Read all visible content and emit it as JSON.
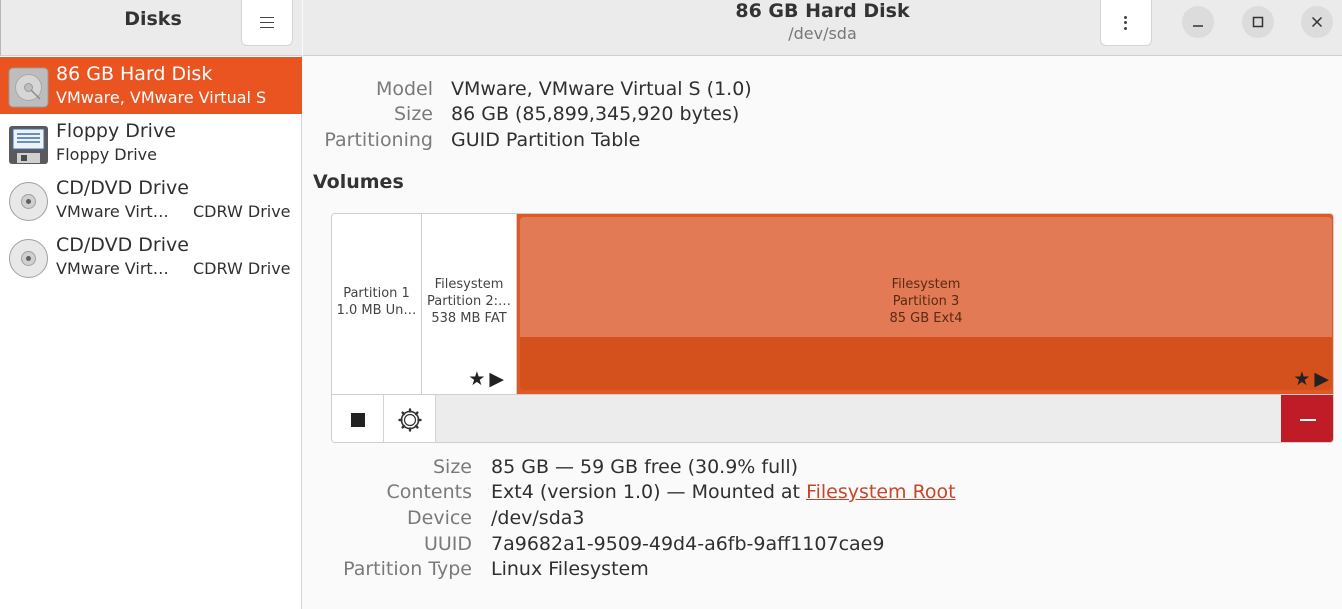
{
  "sidebar": {
    "title": "Disks",
    "menu_icon": "hamburger-menu-icon",
    "devices": [
      {
        "name": "86 GB Hard Disk",
        "sub": "VMware, VMware Virtual S",
        "sub2": "",
        "icon": "hard-disk-icon",
        "selected": true
      },
      {
        "name": "Floppy Drive",
        "sub": "Floppy Drive",
        "sub2": "",
        "icon": "floppy-drive-icon",
        "selected": false
      },
      {
        "name": "CD/DVD Drive",
        "sub": "VMware Virt…",
        "sub2": "CDRW Drive",
        "icon": "optical-drive-icon",
        "selected": false
      },
      {
        "name": "CD/DVD Drive",
        "sub": "VMware Virt…",
        "sub2": "CDRW Drive",
        "icon": "optical-drive-icon",
        "selected": false
      }
    ]
  },
  "header": {
    "title": "86 GB Hard Disk",
    "subtitle": "/dev/sda",
    "menu_icon": "kebab-menu-icon",
    "window_controls": [
      "minimize-icon",
      "maximize-icon",
      "close-icon"
    ]
  },
  "drive": {
    "model_label": "Model",
    "model_value": "VMware, VMware Virtual S (1.0)",
    "size_label": "Size",
    "size_value": "86 GB (85,899,345,920 bytes)",
    "partitioning_label": "Partitioning",
    "partitioning_value": "GUID Partition Table"
  },
  "volumes": {
    "heading": "Volumes",
    "partitions": [
      {
        "line1": "Partition 1",
        "line2": "1.0 MB Un…",
        "line3": "",
        "selected": false,
        "icons": ""
      },
      {
        "line1": "Filesystem",
        "line2": "Partition 2:…",
        "line3": "538 MB FAT",
        "selected": false,
        "icons": "★▶"
      },
      {
        "line1": "Filesystem",
        "line2": "Partition 3",
        "line3": "85 GB Ext4",
        "selected": true,
        "icons": "★▶"
      }
    ],
    "toolbar": {
      "stop_icon": "stop-icon",
      "settings_icon": "gear-icon",
      "delete_icon": "minus-icon"
    }
  },
  "partition": {
    "size_label": "Size",
    "size_value": "85 GB — 59 GB free (30.9% full)",
    "contents_label": "Contents",
    "contents_value": "Ext4 (version 1.0) — Mounted at",
    "contents_link": "Filesystem Root",
    "device_label": "Device",
    "device_value": "/dev/sda3",
    "uuid_label": "UUID",
    "uuid_value": "7a9682a1-9509-49d4-a6fb-9aff1107cae9",
    "type_label": "Partition Type",
    "type_value": "Linux Filesystem"
  },
  "colors": {
    "accent": "#e95420",
    "destructive": "#c01c28",
    "link": "#c7462a"
  }
}
